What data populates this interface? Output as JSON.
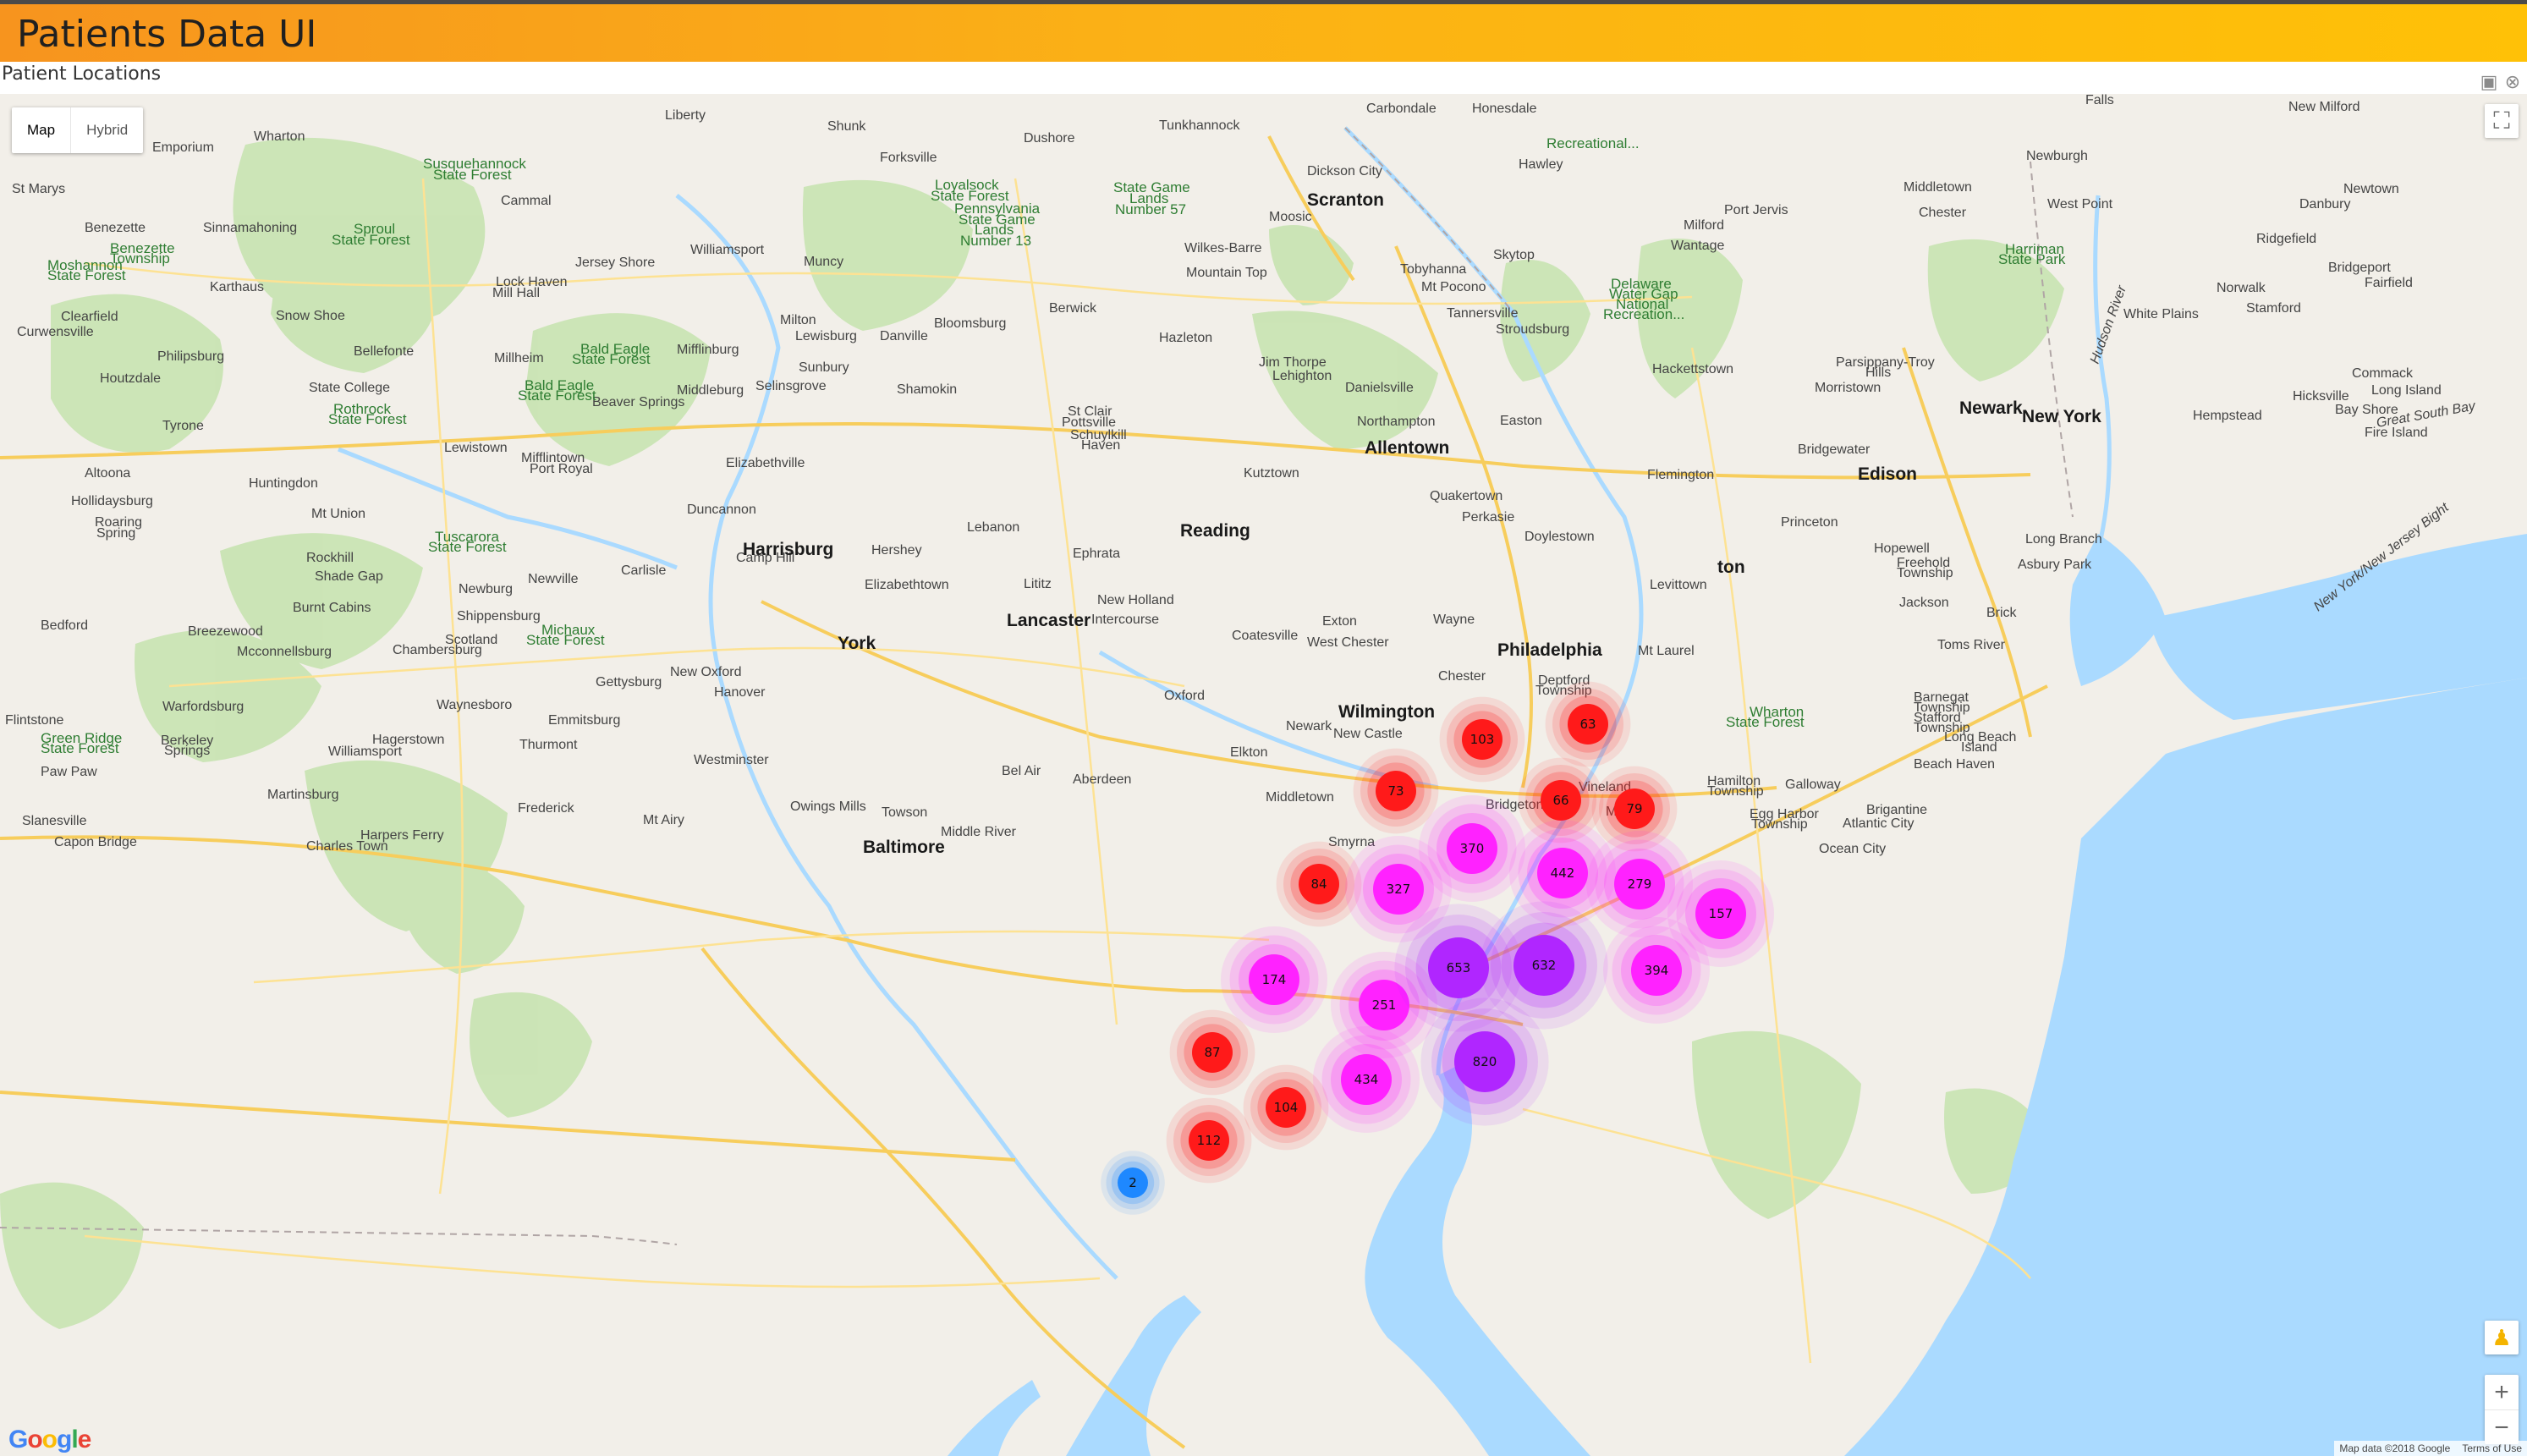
{
  "header": {
    "title": "Patients Data UI"
  },
  "section": {
    "title": "Patient Locations"
  },
  "map_type": {
    "options": [
      "Map",
      "Hybrid"
    ],
    "active": "Map"
  },
  "panel_icons": [
    "camera-icon",
    "close-icon"
  ],
  "controls": {
    "fullscreen_icon": "fullscreen-icon",
    "pegman_icon": "pegman-icon",
    "zoom_in": "+",
    "zoom_out": "−"
  },
  "branding": {
    "logo": "Google"
  },
  "attribution": {
    "map_data": "Map data ©2018 Google",
    "terms": "Terms of Use"
  },
  "colors": {
    "small_cluster": "#ff1a1a",
    "medium_cluster": "#ff22ff",
    "large_cluster": "#b026ff",
    "tiny_cluster": "#1e88ff",
    "water": "#aadaff",
    "park": "#c8e6b4"
  },
  "clusters": [
    {
      "count": "2",
      "tier": "tiny"
    },
    {
      "count": "63",
      "tier": "small"
    },
    {
      "count": "66",
      "tier": "small"
    },
    {
      "count": "73",
      "tier": "small"
    },
    {
      "count": "79",
      "tier": "small"
    },
    {
      "count": "84",
      "tier": "small"
    },
    {
      "count": "87",
      "tier": "small"
    },
    {
      "count": "103",
      "tier": "small"
    },
    {
      "count": "104",
      "tier": "small"
    },
    {
      "count": "112",
      "tier": "small"
    },
    {
      "count": "157",
      "tier": "medium"
    },
    {
      "count": "174",
      "tier": "medium"
    },
    {
      "count": "251",
      "tier": "medium"
    },
    {
      "count": "279",
      "tier": "medium"
    },
    {
      "count": "327",
      "tier": "medium"
    },
    {
      "count": "370",
      "tier": "medium"
    },
    {
      "count": "394",
      "tier": "medium"
    },
    {
      "count": "434",
      "tier": "medium"
    },
    {
      "count": "442",
      "tier": "medium"
    },
    {
      "count": "632",
      "tier": "large"
    },
    {
      "count": "653",
      "tier": "large"
    },
    {
      "count": "820",
      "tier": "large"
    }
  ],
  "places": {
    "cities": [
      "New York",
      "Philadelphia",
      "Newark",
      "Allentown",
      "Reading",
      "Harrisburg",
      "Lancaster",
      "York",
      "Wilmington",
      "Baltimore",
      "Trenton",
      "Scranton",
      "Wilkes-Barre",
      "Edison"
    ],
    "towns": [
      "Wharton",
      "Emporium",
      "Liberty",
      "Shunk",
      "Forksville",
      "Dushore",
      "Carbondale",
      "Honesdale",
      "Falls",
      "New Milford",
      "Tunkhannock",
      "Dickson City",
      "Hawley",
      "Newburgh",
      "Middletown",
      "West Point",
      "Danbury",
      "Newtown",
      "St Marys",
      "Cammal",
      "Benezette",
      "Sinnamahoning",
      "Moosic",
      "Milford",
      "Port Jervis",
      "Chester",
      "Ridgefield",
      "Williamsport",
      "Muncy",
      "Jersey Shore",
      "Skytop",
      "Wantage",
      "Bridgeport",
      "Fairfield",
      "Karthaus",
      "Lock Haven",
      "Mill Hall",
      "Mountain Top",
      "Tobyhanna",
      "Mt Pocono",
      "Norwalk",
      "Clearfield",
      "Snow Shoe",
      "Milton",
      "Berwick",
      "Tannersville",
      "White Plains",
      "Stamford",
      "Curwensville",
      "Bloomsburg",
      "Lewisburg",
      "Danville",
      "Hazleton",
      "Stroudsburg",
      "Philipsburg",
      "Bellefonte",
      "Millheim",
      "Mifflinburg",
      "Sunbury",
      "Jim Thorpe",
      "Lehighton",
      "Hackettstown",
      "Parsippany-Troy Hills",
      "Houtzdale",
      "State College",
      "Middleburg",
      "Selinsgrove",
      "Shamokin",
      "Danielsville",
      "Morristown",
      "Commack",
      "Long Island",
      "Hicksville",
      "Beaver Springs",
      "St Clair",
      "Pottsville",
      "Schuylkill Haven",
      "Northampton",
      "Easton",
      "Hempstead",
      "Bay Shore",
      "Fire Island",
      "Tyrone",
      "Lewistown",
      "Mifflintown",
      "Port Royal",
      "Elizabethville",
      "Bridgewater",
      "Altoona",
      "Huntingdon",
      "Kutztown",
      "Quakertown",
      "Flemington",
      "Hollidaysburg",
      "Mt Union",
      "Duncannon",
      "Perkasie",
      "Doylestown",
      "Princeton",
      "Roaring Spring",
      "Lebanon",
      "Hershey",
      "Long Branch",
      "Camp Hill",
      "Carlisle",
      "Ephrata",
      "Lititz",
      "Freehold Township",
      "Asbury Park",
      "Rockhill",
      "Shade Gap",
      "Newville",
      "Elizabethtown",
      "Levittown",
      "Bedford",
      "Burnt Cabins",
      "Newburg",
      "New Holland",
      "Intercourse",
      "Exton",
      "Wayne",
      "Jackson",
      "Brick",
      "Breezewood",
      "Shippensburg",
      "Mcconnellsburg",
      "Chambersburg",
      "Scotland",
      "Coatesville",
      "West Chester",
      "Toms River",
      "Mt Laurel",
      "Gettysburg",
      "New Oxford",
      "Hanover",
      "Chester",
      "Oxford",
      "Deptford Township",
      "Warfordsburg",
      "Waynesboro",
      "Flintstone",
      "Emmitsburg",
      "Berkeley Springs",
      "Hagerstown",
      "Thurmont",
      "Williamsport",
      "Newark",
      "New Castle",
      "Elkton",
      "Bel Air",
      "Aberdeen",
      "Westminster",
      "Vineland",
      "Millville",
      "Hamilton Township",
      "Galloway",
      "Paw Paw",
      "Martinsburg",
      "Frederick",
      "Owings Mills",
      "Towson",
      "Bridgeton",
      "Egg Harbor Township",
      "Brigantine",
      "Atlantic City",
      "Slanesville",
      "Mt Airy",
      "Middle River",
      "Smyrna",
      "Ocean City",
      "Harpers Ferry",
      "Charles Town",
      "Capon Bridge",
      "Barnegat Township",
      "Stafford Township",
      "Long Beach Island",
      "Beach Haven",
      "Middletown",
      "Hopewell"
    ],
    "parks": [
      "Susquehannock State Forest",
      "Loyalsock State Forest",
      "State Game Lands Number 57",
      "Pennsylvania State Game Lands Number 13",
      "Moshannon State Forest",
      "Sproul State Forest",
      "Benezette Township",
      "Bald Eagle State Forest",
      "Rothrock State Forest",
      "Delaware Water Gap National Recreation...",
      "Harriman State Park",
      "Tuscarora State Forest",
      "Michaux State Forest",
      "Wharton State Forest",
      "Green Ridge State Forest",
      "Recreational..."
    ],
    "water": [
      "Hudson River",
      "Great South Bay",
      "New York/New Jersey Bight"
    ]
  }
}
